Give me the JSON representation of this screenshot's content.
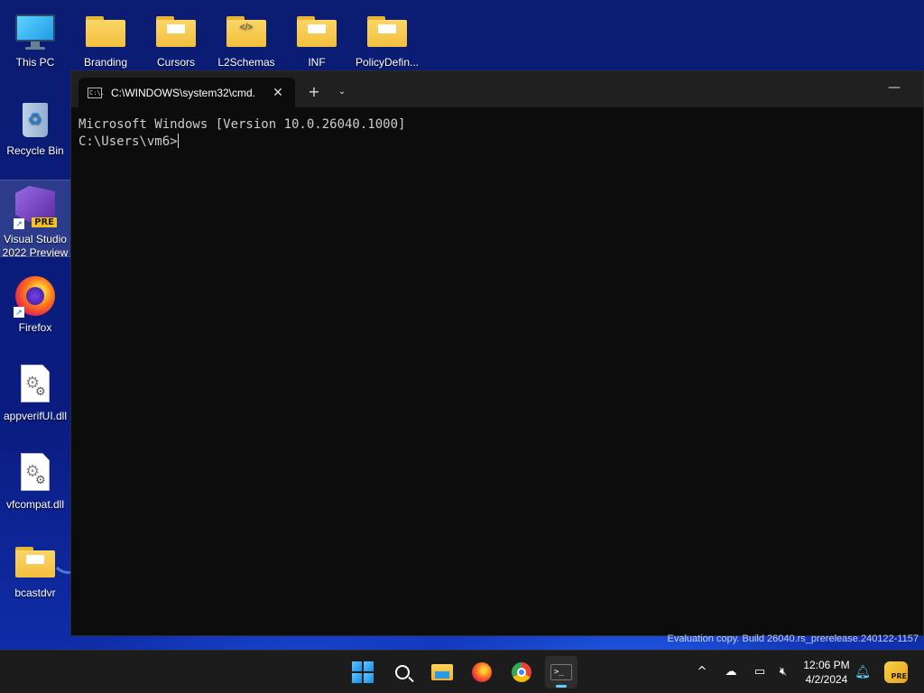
{
  "desktop": {
    "icons": [
      {
        "label": "This PC"
      },
      {
        "label": "Branding"
      },
      {
        "label": "Cursors"
      },
      {
        "label": "L2Schemas"
      },
      {
        "label": "INF"
      },
      {
        "label": "PolicyDefin..."
      },
      {
        "label": "Recycle Bin"
      },
      {
        "label": "Visual Studio 2022 Preview",
        "badge": "PRE"
      },
      {
        "label": "Firefox"
      },
      {
        "label": "appverifUI.dll"
      },
      {
        "label": "vfcompat.dll"
      },
      {
        "label": "bcastdvr"
      }
    ],
    "watermark": "Evaluation copy. Build 26040.rs_prerelease.240122-1157"
  },
  "terminal": {
    "tab_title": "C:\\WINDOWS\\system32\\cmd.",
    "tab_icon_text": "C:\\.",
    "new_tab_label": "+",
    "dropdown_label": "⌄",
    "close_label": "✕",
    "minimize_label": "—",
    "lines": [
      "Microsoft Windows [Version 10.0.26040.1000]",
      "",
      "C:\\Users\\vm6>"
    ]
  },
  "taskbar": {
    "terminal_glyph": ">_",
    "tray": {
      "chevron": "^",
      "time": "12:06 PM",
      "date": "4/2/2024",
      "copilot_badge": "PRE"
    }
  },
  "colors": {
    "terminal_bg": "#0c0c0c",
    "terminal_text": "#cccccc",
    "accent": "#60cdff"
  }
}
